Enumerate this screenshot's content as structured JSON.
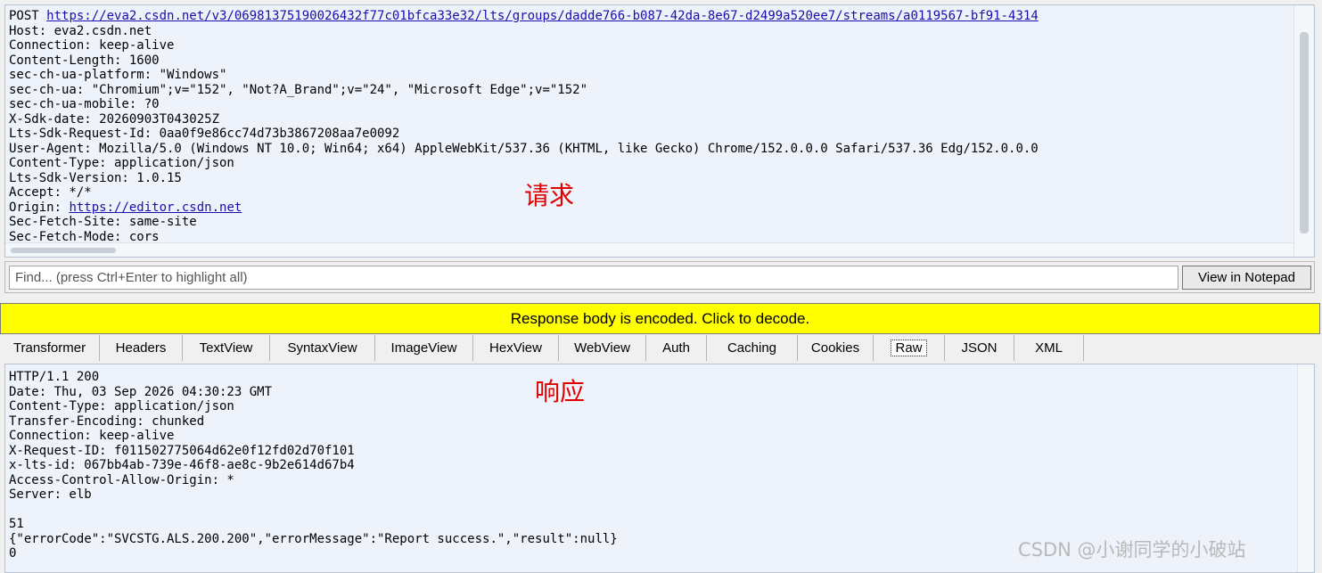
{
  "request": {
    "method": "POST",
    "url": "https://eva2.csdn.net/v3/06981375190026432f77c01bfca33e32/lts/groups/dadde766-b087-42da-8e67-d2499a520ee7/streams/a0119567-bf91-4314",
    "headers": [
      "Host: eva2.csdn.net",
      "Connection: keep-alive",
      "Content-Length: 1600",
      "sec-ch-ua-platform: \"Windows\"",
      "sec-ch-ua: \"Chromium\";v=\"152\", \"Not?A_Brand\";v=\"24\", \"Microsoft Edge\";v=\"152\"",
      "sec-ch-ua-mobile: ?0",
      "X-Sdk-date: 20260903T043025Z",
      "Lts-Sdk-Request-Id: 0aa0f9e86cc74d73b3867208aa7e0092",
      "User-Agent: Mozilla/5.0 (Windows NT 10.0; Win64; x64) AppleWebKit/537.36 (KHTML, like Gecko) Chrome/152.0.0.0 Safari/537.36 Edg/152.0.0.0",
      "Content-Type: application/json",
      "Lts-Sdk-Version: 1.0.15",
      "Accept: */*"
    ],
    "origin_label": "Origin: ",
    "origin_url": "https://editor.csdn.net",
    "headers_after": [
      "Sec-Fetch-Site: same-site",
      "Sec-Fetch-Mode: cors"
    ],
    "annotation": "请求"
  },
  "findbar": {
    "placeholder": "Find... (press Ctrl+Enter to highlight all)",
    "notepad_button": "View in Notepad"
  },
  "encoded_notice": "Response body is encoded. Click to decode.",
  "tabs": [
    "Transformer",
    "Headers",
    "TextView",
    "SyntaxView",
    "ImageView",
    "HexView",
    "WebView",
    "Auth",
    "Caching",
    "Cookies",
    "Raw",
    "JSON",
    "XML"
  ],
  "active_tab": "Raw",
  "response": {
    "lines": [
      "HTTP/1.1 200",
      "Date: Thu, 03 Sep 2026 04:30:23 GMT",
      "Content-Type: application/json",
      "Transfer-Encoding: chunked",
      "Connection: keep-alive",
      "X-Request-ID: f011502775064d62e0f12fd02d70f101",
      "x-lts-id: 067bb4ab-739e-46f8-ae8c-9b2e614d67b4",
      "Access-Control-Allow-Origin: *",
      "Server: elb",
      "",
      "51",
      "{\"errorCode\":\"SVCSTG.ALS.200.200\",\"errorMessage\":\"Report success.\",\"result\":null}",
      "0"
    ],
    "annotation": "响应"
  },
  "watermark": "CSDN @小谢同学的小破站"
}
